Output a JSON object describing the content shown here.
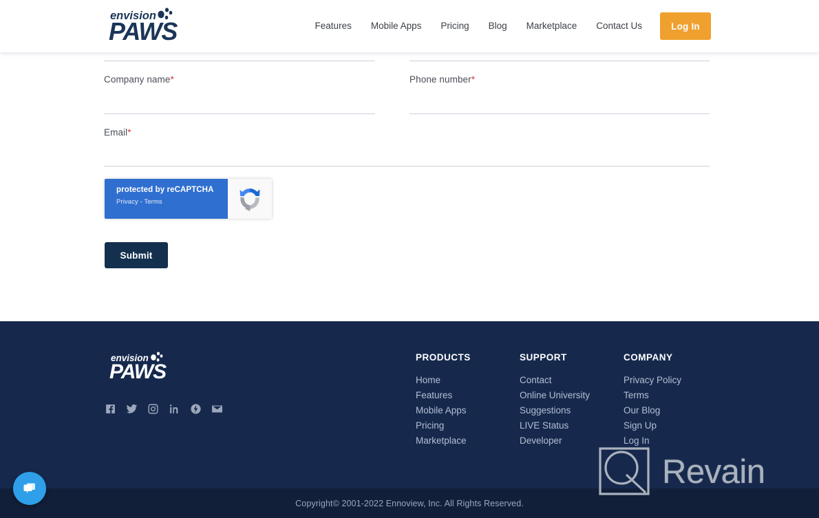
{
  "header": {
    "logo": {
      "top_word": "envision",
      "main_word": "PAWS",
      "icon": "paw-print-icon"
    },
    "nav": [
      {
        "label": "Features"
      },
      {
        "label": "Mobile Apps"
      },
      {
        "label": "Pricing"
      },
      {
        "label": "Blog"
      },
      {
        "label": "Marketplace"
      },
      {
        "label": "Contact Us"
      }
    ],
    "login_label": "Log In",
    "login_color": "#efa02e"
  },
  "form": {
    "fields": [
      {
        "label": "Company name",
        "required": "*",
        "value": "",
        "placeholder": ""
      },
      {
        "label": "Phone number",
        "required": "*",
        "value": "",
        "placeholder": ""
      },
      {
        "label": "Email",
        "required": "*",
        "value": "",
        "placeholder": ""
      }
    ],
    "required_mark": "*",
    "recaptcha": {
      "title": "protected by reCAPTCHA",
      "subtitle": "Privacy - Terms",
      "icon": "recaptcha-logo-icon",
      "bg_color": "#2f6fd0"
    },
    "submit_label": "Submit",
    "submit_color": "#14304f"
  },
  "footer": {
    "bg_color": "#16294d",
    "logo": {
      "top_word": "envision",
      "main_word": "PAWS"
    },
    "social": [
      {
        "name": "facebook-icon"
      },
      {
        "name": "twitter-icon"
      },
      {
        "name": "instagram-icon"
      },
      {
        "name": "linkedin-icon"
      },
      {
        "name": "pulse-icon"
      },
      {
        "name": "email-icon"
      }
    ],
    "columns": [
      {
        "title": "PRODUCTS",
        "links": [
          "Home",
          "Features",
          "Mobile Apps",
          "Pricing",
          "Marketplace"
        ]
      },
      {
        "title": "SUPPORT",
        "links": [
          "Contact",
          "Online University",
          "Suggestions",
          "LIVE Status",
          "Developer"
        ]
      },
      {
        "title": "COMPANY",
        "links": [
          "Privacy Policy",
          "Terms",
          "Our Blog",
          "Sign Up",
          "Log In"
        ]
      }
    ],
    "copyright": "Copyright© 2001-2022 Ennoview, Inc. All Rights Reserved."
  },
  "chat_widget": {
    "icon": "chat-bubbles-icon",
    "color": "#2e9fe8"
  },
  "watermark": {
    "text": "Revain",
    "icon": "revain-logo-icon"
  }
}
